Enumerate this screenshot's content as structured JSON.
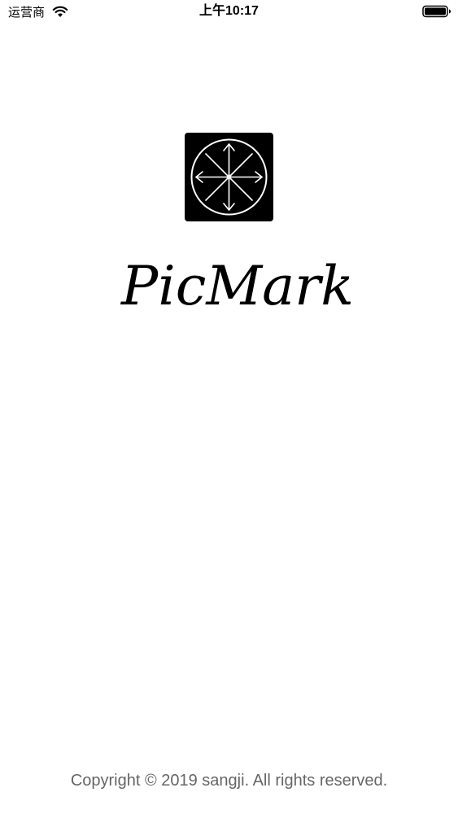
{
  "status_bar": {
    "carrier": "运营商",
    "time": "上午10:17",
    "wifi_icon": "wifi-icon",
    "battery_icon": "battery-icon"
  },
  "splash": {
    "app_logo_icon": "compass-arrows-icon",
    "app_name": "PicMark"
  },
  "footer": {
    "copyright": "Copyright © 2019 sangji. All rights reserved."
  },
  "colors": {
    "background": "#ffffff",
    "logo_background": "#000000",
    "logo_stroke": "#ffffff",
    "copyright_text": "#666666"
  }
}
